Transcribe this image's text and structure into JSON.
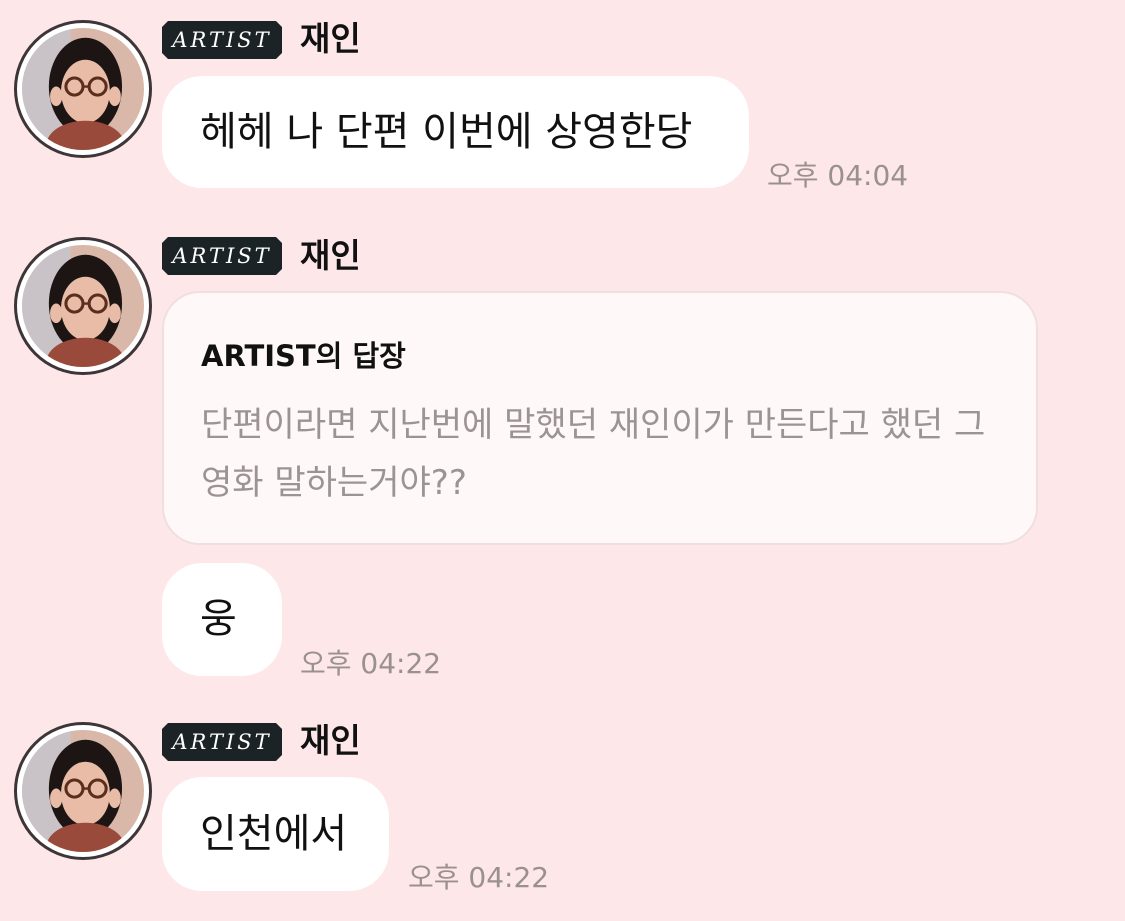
{
  "messages": [
    {
      "badge": "ARTIST",
      "sender": "재인",
      "text": "헤헤 나 단편 이번에 상영한당",
      "time": "오후 04:04"
    },
    {
      "badge": "ARTIST",
      "sender": "재인",
      "reply_title": "ARTIST의 답장",
      "reply_body": "단편이라면 지난번에 말했던 재인이가 만든다고 했던 그 영화 말하는거야??",
      "text": "웅",
      "time": "오후 04:22"
    },
    {
      "badge": "ARTIST",
      "sender": "재인",
      "text": "인천에서",
      "time": "오후 04:22"
    }
  ],
  "colors": {
    "background": "#fde7e8",
    "bubble": "#ffffff",
    "badge": "#1c2326",
    "timestamp": "#9a9090"
  },
  "icons": [
    "avatar-photo"
  ]
}
